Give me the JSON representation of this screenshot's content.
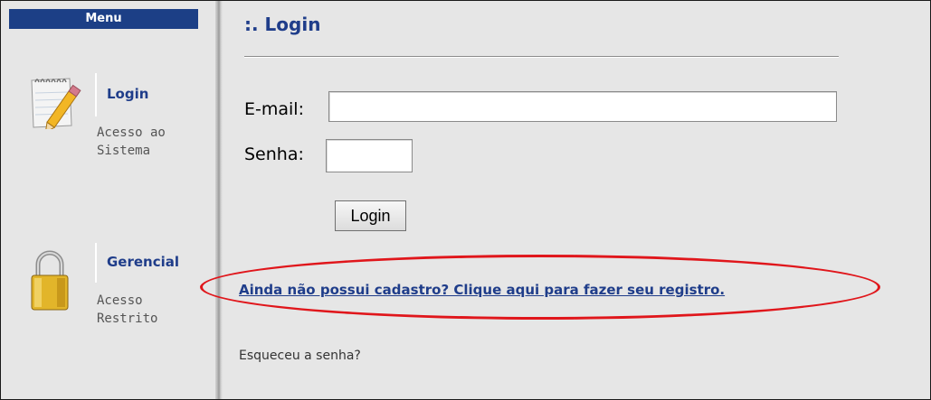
{
  "sidebar": {
    "menu_title": "Menu",
    "items": [
      {
        "title": "Login",
        "description": "Acesso ao Sistema",
        "icon": "notepad-pencil-icon"
      },
      {
        "title": "Gerencial",
        "description": "Acesso Restrito",
        "icon": "padlock-icon"
      }
    ]
  },
  "main": {
    "page_title": ":. Login",
    "email_label": "E-mail:",
    "email_value": "",
    "password_label": "Senha:",
    "password_value": "",
    "login_button": "Login",
    "register_link": "Ainda não possui cadastro? Clique aqui para fazer seu registro.",
    "forgot_link": "Esqueceu a senha?"
  },
  "colors": {
    "menu_header_bg": "#1c3f86",
    "title_blue": "#1f3d8a",
    "annotation_red": "#e0161b",
    "background": "#e6e6e6"
  }
}
